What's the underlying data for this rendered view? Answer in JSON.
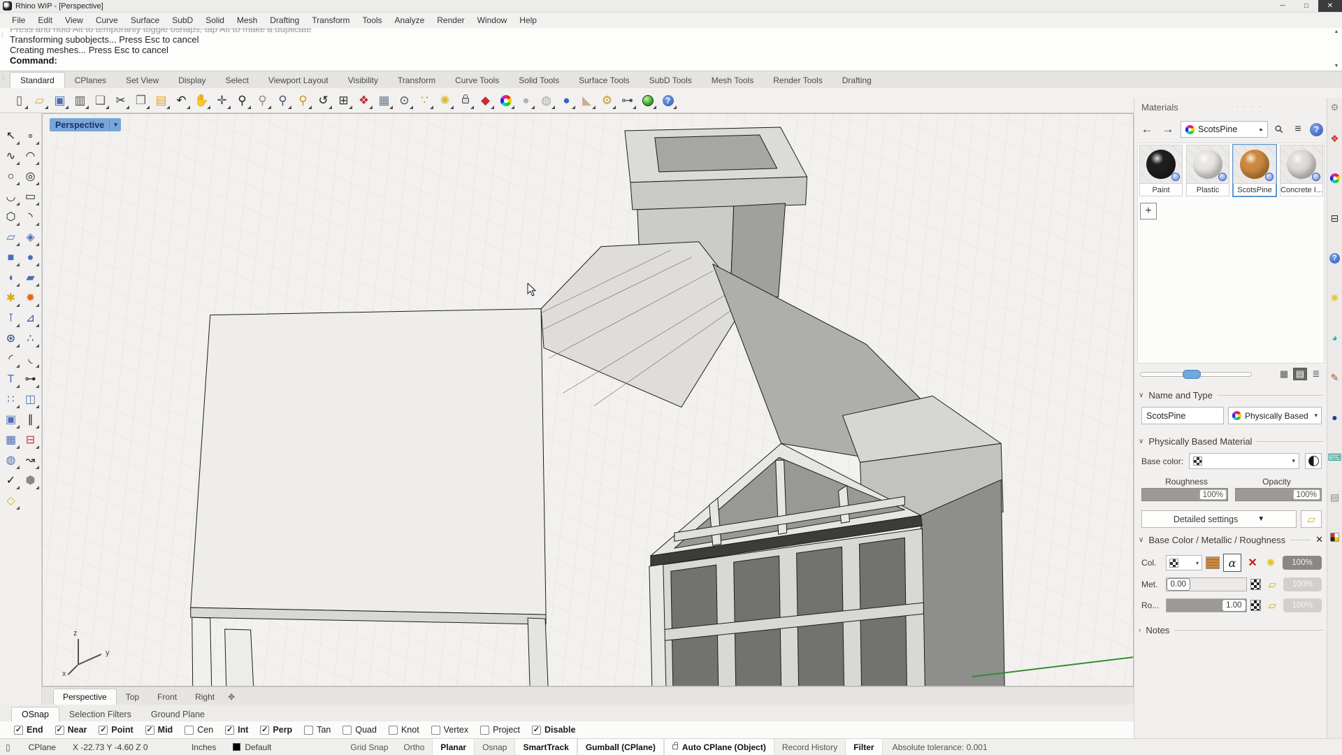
{
  "window": {
    "title": "Rhino WIP - [Perspective]",
    "controls": [
      {
        "name": "minimize-button",
        "glyph": "─"
      },
      {
        "name": "maximize-button",
        "glyph": "□"
      },
      {
        "name": "close-button",
        "glyph": "✕"
      }
    ]
  },
  "menu": {
    "items": [
      {
        "name": "menu-file",
        "label": "File"
      },
      {
        "name": "menu-edit",
        "label": "Edit"
      },
      {
        "name": "menu-view",
        "label": "View"
      },
      {
        "name": "menu-curve",
        "label": "Curve"
      },
      {
        "name": "menu-surface",
        "label": "Surface"
      },
      {
        "name": "menu-subd",
        "label": "SubD"
      },
      {
        "name": "menu-solid",
        "label": "Solid"
      },
      {
        "name": "menu-mesh",
        "label": "Mesh"
      },
      {
        "name": "menu-drafting",
        "label": "Drafting"
      },
      {
        "name": "menu-transform",
        "label": "Transform"
      },
      {
        "name": "menu-tools",
        "label": "Tools"
      },
      {
        "name": "menu-analyze",
        "label": "Analyze"
      },
      {
        "name": "menu-render",
        "label": "Render"
      },
      {
        "name": "menu-window",
        "label": "Window"
      },
      {
        "name": "menu-help",
        "label": "Help"
      }
    ]
  },
  "command": {
    "history": [
      {
        "text": "Press and hold Alt to temporarily toggle osnaps, tap Alt to make a duplicate",
        "muted": true
      },
      {
        "text": "Transforming subobjects... Press Esc to cancel"
      },
      {
        "text": "Creating meshes... Press Esc to cancel"
      }
    ],
    "prompt": "Command:"
  },
  "toolbar_tabs": {
    "items": [
      {
        "name": "tab-standard",
        "label": "Standard",
        "active": true
      },
      {
        "name": "tab-cplanes",
        "label": "CPlanes"
      },
      {
        "name": "tab-set-view",
        "label": "Set View"
      },
      {
        "name": "tab-display",
        "label": "Display"
      },
      {
        "name": "tab-select",
        "label": "Select"
      },
      {
        "name": "tab-viewport-layout",
        "label": "Viewport Layout"
      },
      {
        "name": "tab-visibility",
        "label": "Visibility"
      },
      {
        "name": "tab-transform",
        "label": "Transform"
      },
      {
        "name": "tab-curve-tools",
        "label": "Curve Tools"
      },
      {
        "name": "tab-solid-tools",
        "label": "Solid Tools"
      },
      {
        "name": "tab-surface-tools",
        "label": "Surface Tools"
      },
      {
        "name": "tab-subd-tools",
        "label": "SubD Tools"
      },
      {
        "name": "tab-mesh-tools",
        "label": "Mesh Tools"
      },
      {
        "name": "tab-render-tools",
        "label": "Render Tools"
      },
      {
        "name": "tab-drafting",
        "label": "Drafting"
      }
    ]
  },
  "toolbar_icons": [
    {
      "name": "new-file-icon",
      "glyph": "▯",
      "color": "#555553"
    },
    {
      "name": "open-file-icon",
      "glyph": "▱",
      "color": "#dfa22a"
    },
    {
      "name": "save-icon",
      "glyph": "▣",
      "color": "#4a6fae"
    },
    {
      "name": "print-icon",
      "glyph": "▥",
      "color": "#55534f"
    },
    {
      "name": "duplicate-icon",
      "glyph": "❏",
      "color": "#6a6866"
    },
    {
      "name": "cut-icon",
      "glyph": "✂",
      "color": "#333331"
    },
    {
      "name": "copy-icon",
      "glyph": "❐",
      "color": "#6a6866"
    },
    {
      "name": "paste-icon",
      "glyph": "▤",
      "color": "#dfa22a"
    },
    {
      "name": "undo-icon",
      "glyph": "↶",
      "color": "#222220"
    },
    {
      "name": "pan-hand-icon",
      "glyph": "✋",
      "color": "#bf9760"
    },
    {
      "name": "rotate-view-icon",
      "glyph": "✛",
      "color": "#44424e"
    },
    {
      "name": "zoom-icon",
      "glyph": "⚲",
      "color": "#222220"
    },
    {
      "name": "zoom-window-icon",
      "glyph": "⚲",
      "color": "#8a8886"
    },
    {
      "name": "zoom-selected-icon",
      "glyph": "⚲",
      "color": "#44506e"
    },
    {
      "name": "zoom-extents-icon",
      "glyph": "⚲",
      "color": "#c9941c"
    },
    {
      "name": "zoom-back-icon",
      "glyph": "↺",
      "color": "#222220"
    },
    {
      "name": "viewport-layout-icon",
      "glyph": "⊞",
      "color": "#333331"
    },
    {
      "name": "car-icon",
      "glyph": "❖",
      "color": "#c23030"
    },
    {
      "name": "checkered-plane-icon",
      "glyph": "▦",
      "color": "#6a7a8a"
    },
    {
      "name": "cplane-icon",
      "glyph": "⊙",
      "color": "#44424e"
    },
    {
      "name": "points-diagram-icon",
      "glyph": "∵",
      "color": "#d08020"
    },
    {
      "name": "lamp-icon",
      "glyph": "✺",
      "color": "#d8b830"
    },
    {
      "name": "lock-icon",
      "glyph": "",
      "shape": "lock",
      "color": "#444442"
    },
    {
      "name": "render-icon",
      "glyph": "◆",
      "color": "#c03030"
    },
    {
      "name": "color-wheel-icon",
      "glyph": "",
      "shape": "wheel",
      "color": "#444442"
    },
    {
      "name": "shaded-view-icon",
      "glyph": "●",
      "color": "#b2b2b0"
    },
    {
      "name": "ghosted-view-icon",
      "glyph": "◍",
      "color": "#a8a8a6"
    },
    {
      "name": "rendered-view-icon",
      "glyph": "●",
      "color": "#2f62c8"
    },
    {
      "name": "cone-icon",
      "glyph": "◣",
      "color": "#c8b090"
    },
    {
      "name": "gears-icon",
      "glyph": "⚙",
      "color": "#c8a020"
    },
    {
      "name": "history-icon",
      "glyph": "⊶",
      "color": "#445064"
    },
    {
      "name": "earth-icon",
      "glyph": "",
      "shape": "earth",
      "color": "#2a7a28"
    },
    {
      "name": "help-icon",
      "glyph": "?",
      "shape": "help",
      "color": "#2f55b8"
    }
  ],
  "left_toolbar_icons": [
    {
      "name": "select-arrow-icon",
      "glyph": "↖",
      "color": "#222220"
    },
    {
      "name": "point-icon",
      "glyph": "∘",
      "color": "#222220"
    },
    {
      "name": "control-point-curve-icon",
      "glyph": "∿",
      "color": "#222220"
    },
    {
      "name": "arc-icon",
      "glyph": "◠",
      "color": "#222220"
    },
    {
      "name": "circle-icon",
      "glyph": "○",
      "color": "#222220"
    },
    {
      "name": "ellipse-icon",
      "glyph": "◎",
      "color": "#222220"
    },
    {
      "name": "freeform-curve-icon",
      "glyph": "◡",
      "color": "#222220"
    },
    {
      "name": "rectangle-icon",
      "glyph": "▭",
      "color": "#222220"
    },
    {
      "name": "polygon-icon",
      "glyph": "⬡",
      "color": "#222220"
    },
    {
      "name": "blend-curve-icon",
      "glyph": "◝",
      "color": "#222220"
    },
    {
      "name": "surface-icon",
      "glyph": "▱",
      "color": "#4a6fb5"
    },
    {
      "name": "patch-icon",
      "glyph": "◈",
      "color": "#4a6fb5"
    },
    {
      "name": "box-icon",
      "glyph": "■",
      "color": "#4a6fb5"
    },
    {
      "name": "sphere-icon",
      "glyph": "●",
      "color": "#4a6fb5"
    },
    {
      "name": "revolve-icon",
      "glyph": "◖",
      "color": "#4a6fb5"
    },
    {
      "name": "sweep-icon",
      "glyph": "▰",
      "color": "#4a6fb5"
    },
    {
      "name": "puzzle-icon",
      "glyph": "✱",
      "color": "#d8a818"
    },
    {
      "name": "explode-icon",
      "glyph": "✸",
      "color": "#e06818"
    },
    {
      "name": "trim-icon",
      "glyph": "⊺",
      "color": "#3355aa"
    },
    {
      "name": "split-icon",
      "glyph": "⊿",
      "color": "#3355aa"
    },
    {
      "name": "boolean-icon",
      "glyph": "⊛",
      "color": "#223a7a"
    },
    {
      "name": "points-on-icon",
      "glyph": "∴",
      "color": "#223a7a"
    },
    {
      "name": "fillet-icon",
      "glyph": "◜",
      "color": "#222220"
    },
    {
      "name": "chamfer-icon",
      "glyph": "◟",
      "color": "#222220"
    },
    {
      "name": "text-icon",
      "glyph": "T",
      "color": "#4a6fb5"
    },
    {
      "name": "point-edit-icon",
      "glyph": "⊶",
      "color": "#222220"
    },
    {
      "name": "array-icon",
      "glyph": "∷",
      "color": "#4a6fb5"
    },
    {
      "name": "mirror-icon",
      "glyph": "◫",
      "color": "#4a6fb5"
    },
    {
      "name": "solid-union-icon",
      "glyph": "▣",
      "color": "#4a6fb5"
    },
    {
      "name": "extrude-icon",
      "glyph": "∥",
      "color": "#222220"
    },
    {
      "name": "grid-array-icon",
      "glyph": "▦",
      "color": "#4a6fb5"
    },
    {
      "name": "block-icon",
      "glyph": "⊟",
      "color": "#c03030"
    },
    {
      "name": "twist-icon",
      "glyph": "◍",
      "color": "#4a6fb5"
    },
    {
      "name": "flow-icon",
      "glyph": "↝",
      "color": "#222220"
    },
    {
      "name": "check-icon",
      "glyph": "✓",
      "color": "#111111"
    },
    {
      "name": "mesh-icon",
      "glyph": "⬢",
      "color": "#8a8886"
    },
    {
      "name": "unroll-icon",
      "glyph": "◇",
      "color": "#d8b018"
    }
  ],
  "viewport": {
    "label": "Perspective",
    "axis": {
      "x": "x",
      "y": "y",
      "z": "z"
    },
    "tabs": [
      {
        "name": "viewport-tab-perspective",
        "label": "Perspective",
        "active": true
      },
      {
        "name": "viewport-tab-top",
        "label": "Top"
      },
      {
        "name": "viewport-tab-front",
        "label": "Front"
      },
      {
        "name": "viewport-tab-right",
        "label": "Right"
      }
    ]
  },
  "bottom_tabs": {
    "items": [
      {
        "name": "tab-osnap",
        "label": "OSnap",
        "active": true
      },
      {
        "name": "tab-selection-filters",
        "label": "Selection Filters"
      },
      {
        "name": "tab-ground-plane",
        "label": "Ground Plane"
      }
    ]
  },
  "osnap": {
    "items": [
      {
        "name": "osnap-end",
        "label": "End",
        "checked": true
      },
      {
        "name": "osnap-near",
        "label": "Near",
        "checked": true
      },
      {
        "name": "osnap-point",
        "label": "Point",
        "checked": true
      },
      {
        "name": "osnap-mid",
        "label": "Mid",
        "checked": true
      },
      {
        "name": "osnap-cen",
        "label": "Cen",
        "checked": false
      },
      {
        "name": "osnap-int",
        "label": "Int",
        "checked": true
      },
      {
        "name": "osnap-perp",
        "label": "Perp",
        "checked": true
      },
      {
        "name": "osnap-tan",
        "label": "Tan",
        "checked": false
      },
      {
        "name": "osnap-quad",
        "label": "Quad",
        "checked": false
      },
      {
        "name": "osnap-knot",
        "label": "Knot",
        "checked": false
      },
      {
        "name": "osnap-vertex",
        "label": "Vertex",
        "checked": false
      },
      {
        "name": "osnap-project",
        "label": "Project",
        "checked": false
      },
      {
        "name": "osnap-disable",
        "label": "Disable",
        "checked": true
      }
    ]
  },
  "status_bar": {
    "cplane_label": "CPlane",
    "coords": "X -22.73   Y -4.60   Z 0",
    "units": "Inches",
    "layer": "Default",
    "panes": [
      {
        "name": "pane-grid-snap",
        "label": "Grid Snap"
      },
      {
        "name": "pane-ortho",
        "label": "Ortho"
      },
      {
        "name": "pane-planar",
        "label": "Planar",
        "active": true
      },
      {
        "name": "pane-osnap",
        "label": "Osnap"
      },
      {
        "name": "pane-smarttrack",
        "label": "SmartTrack",
        "active": true
      },
      {
        "name": "pane-gumball",
        "label": "Gumball (CPlane)",
        "active": true
      },
      {
        "name": "pane-auto-cplane",
        "label": "Auto CPlane (Object)",
        "active": true,
        "lock": true
      },
      {
        "name": "pane-record-history",
        "label": "Record History"
      },
      {
        "name": "pane-filter",
        "label": "Filter",
        "active": true
      }
    ],
    "tolerance": "Absolute tolerance: 0.001"
  },
  "materials_panel": {
    "title": "Materials",
    "breadcrumb": "ScotsPine",
    "materials": [
      {
        "name": "material-paint",
        "label": "Paint",
        "sphere": "#1f1f1f"
      },
      {
        "name": "material-plastic",
        "label": "Plastic",
        "sphere": "#e8e6e4"
      },
      {
        "name": "material-scotspine",
        "label": "ScotsPine",
        "sphere": "#cd8a3f",
        "selected": true
      },
      {
        "name": "material-concrete",
        "label": "Concrete I...",
        "sphere": "#dedcda"
      }
    ],
    "add_label": "+",
    "name_and_type": {
      "header": "Name and Type",
      "name_value": "ScotsPine",
      "type_value": "Physically Based"
    },
    "pbm": {
      "header": "Physically Based Material",
      "base_color_label": "Base color:",
      "roughness_label": "Roughness",
      "roughness_value": "100%",
      "opacity_label": "Opacity",
      "opacity_value": "100%",
      "detailed_settings_label": "Detailed settings"
    },
    "bcmr": {
      "header": "Base Color /  Metallic / Roughness",
      "rows": [
        {
          "label": "Col.",
          "percent": "100%"
        },
        {
          "label": "Met.",
          "value": "0.00",
          "percent": "100%"
        },
        {
          "label": "Ro...",
          "value": "1.00",
          "percent": "100%"
        }
      ]
    },
    "notes_header": "Notes"
  },
  "right_strip_icons": [
    {
      "name": "render-tools-icon",
      "glyph": "❖",
      "color": "#c23030"
    },
    {
      "name": "color-wheel-icon",
      "glyph": "",
      "shape": "wheel",
      "color": "#888"
    },
    {
      "name": "display-icon",
      "glyph": "⊟",
      "color": "#333331"
    },
    {
      "name": "help-sphere-icon",
      "glyph": "?",
      "shape": "help",
      "color": "#2f55b8"
    },
    {
      "name": "lightbulb-icon",
      "glyph": "✺",
      "color": "#e8c830"
    },
    {
      "name": "environment-icon",
      "glyph": "◕",
      "color": "#28b0a8"
    },
    {
      "name": "pen-icon",
      "glyph": "✎",
      "color": "#b05030"
    },
    {
      "name": "eightball-icon",
      "glyph": "●",
      "color": "#203898"
    },
    {
      "name": "calculator-icon",
      "glyph": "⌨",
      "color": "#2a9a8a"
    },
    {
      "name": "notes-list-icon",
      "glyph": "▤",
      "color": "#8a8886"
    },
    {
      "name": "swatches-icon",
      "glyph": "",
      "shape": "quad",
      "color": "#c33"
    }
  ],
  "icons": {
    "dropdown": "▾",
    "dropdown_big": "▼",
    "breadcrumb_arrow": "▸",
    "back": "←",
    "forward": "→",
    "burger": "≡",
    "question": "?",
    "gear": "⚙",
    "dots": "· · · ·",
    "splitter": "✥",
    "scroll_up": "▲",
    "scroll_down": "▼",
    "handle": "⁞",
    "chevron_open": "∨",
    "chevron_closed": "›",
    "close_x": "✕",
    "alpha": "α",
    "red_x": "✕",
    "bulb": "✺",
    "folder": "▱",
    "view_grid": "▦",
    "view_list": "▤",
    "view_detail": "≣",
    "search": "⚲",
    "status_box": "▯"
  }
}
